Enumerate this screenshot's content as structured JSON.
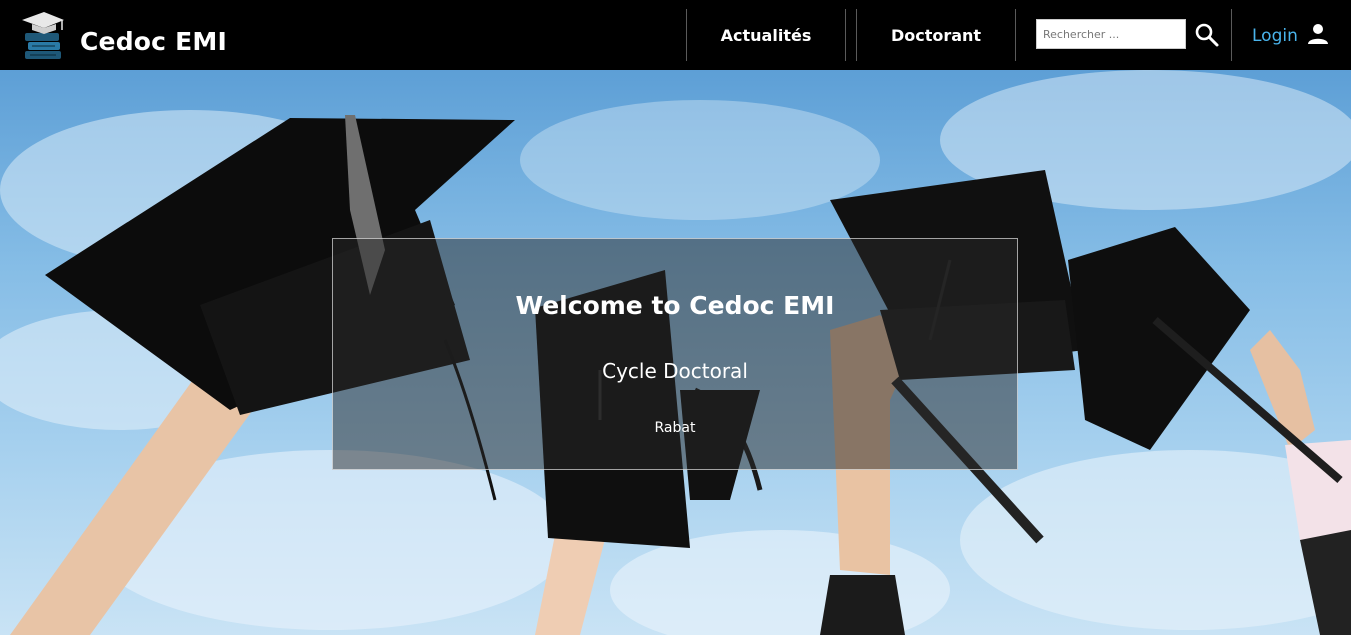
{
  "brand": {
    "name": "Cedoc EMI",
    "logo_icon": "graduation-books-icon"
  },
  "nav": {
    "items": [
      {
        "label": "Actualités"
      },
      {
        "label": "Doctorant"
      }
    ]
  },
  "search": {
    "placeholder": "Rechercher ...",
    "icon": "search-icon"
  },
  "login": {
    "label": "Login",
    "icon": "user-icon"
  },
  "hero": {
    "title": "Welcome to Cedoc EMI",
    "subtitle": "Cycle Doctoral",
    "location": "Rabat"
  },
  "colors": {
    "navbar_bg": "#000000",
    "login_accent": "#4ab4ec",
    "sky": "#86bde6"
  }
}
